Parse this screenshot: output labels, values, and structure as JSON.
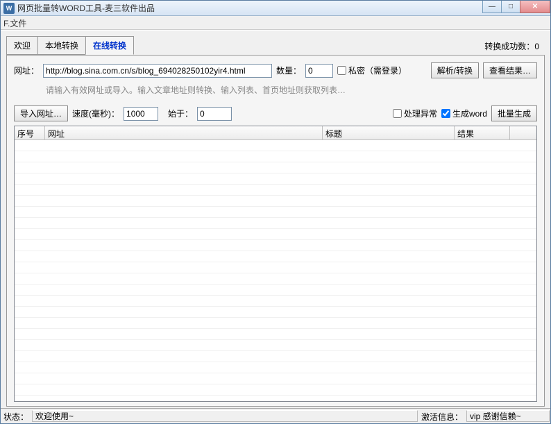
{
  "window": {
    "title": "网页批量转WORD工具-麦三软件出品"
  },
  "menu": {
    "file": "F.文件"
  },
  "tabs": {
    "welcome": "欢迎",
    "local": "本地转换",
    "online": "在线转换",
    "success_label": "转换成功数：",
    "success_count": "0"
  },
  "url_row": {
    "label": "网址：",
    "value": "http://blog.sina.com.cn/s/blog_694028250102yir4.html",
    "qty_label": "数量：",
    "qty_value": "0",
    "private_label": "私密（需登录）",
    "parse_btn": "解析/转换",
    "view_btn": "查看结果…"
  },
  "hint": "请输入有效网址或导入。输入文章地址则转换、输入列表、首页地址则获取列表…",
  "row2": {
    "import_btn": "导入网址…",
    "speed_label": "速度(毫秒)：",
    "speed_value": "1000",
    "start_label": "始于：",
    "start_value": "0",
    "exception_label": "处理异常",
    "genword_label": "生成word",
    "batch_btn": "批量生成"
  },
  "table": {
    "headers": {
      "seq": "序号",
      "url": "网址",
      "title": "标题",
      "result": "结果"
    }
  },
  "status": {
    "state_label": "状态：",
    "state_value": "欢迎使用~",
    "act_label": "激活信息：",
    "act_value": "vip 感谢信赖~"
  }
}
